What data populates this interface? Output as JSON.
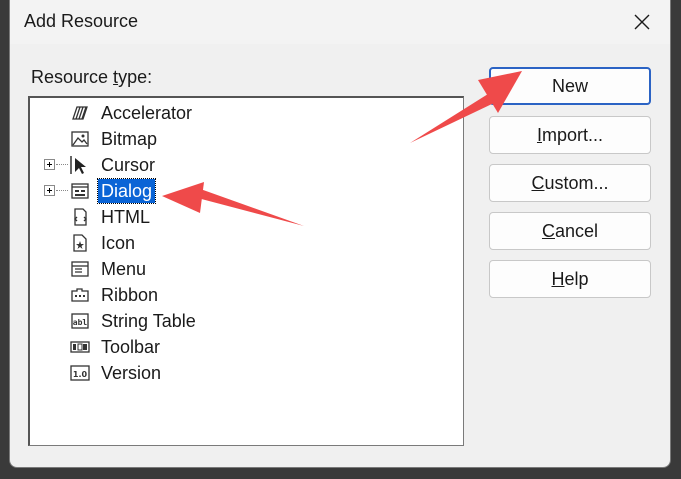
{
  "dialog": {
    "title": "Add Resource",
    "close_glyph": "close-icon"
  },
  "resource_type_label": {
    "pre": "Resource ",
    "ul": "t",
    "post": "ype:"
  },
  "tree": {
    "items": [
      {
        "label": "Accelerator",
        "icon": "accelerator-icon",
        "expandable": false,
        "selected": false
      },
      {
        "label": "Bitmap",
        "icon": "bitmap-icon",
        "expandable": false,
        "selected": false
      },
      {
        "label": "Cursor",
        "icon": "cursor-icon",
        "expandable": true,
        "selected": false
      },
      {
        "label": "Dialog",
        "icon": "dialog-icon",
        "expandable": true,
        "selected": true
      },
      {
        "label": "HTML",
        "icon": "html-icon",
        "expandable": false,
        "selected": false
      },
      {
        "label": "Icon",
        "icon": "icon-resource-icon",
        "expandable": false,
        "selected": false
      },
      {
        "label": "Menu",
        "icon": "menu-icon",
        "expandable": false,
        "selected": false
      },
      {
        "label": "Ribbon",
        "icon": "ribbon-icon",
        "expandable": false,
        "selected": false
      },
      {
        "label": "String Table",
        "icon": "string-table-icon",
        "expandable": false,
        "selected": false
      },
      {
        "label": "Toolbar",
        "icon": "toolbar-icon",
        "expandable": false,
        "selected": false
      },
      {
        "label": "Version",
        "icon": "version-icon",
        "expandable": false,
        "selected": false
      }
    ]
  },
  "buttons": {
    "new": {
      "label": "New"
    },
    "import": {
      "pre": "",
      "ul": "I",
      "post": "mport..."
    },
    "custom": {
      "pre": "",
      "ul": "C",
      "post": "ustom..."
    },
    "cancel": {
      "pre": "",
      "ul": "C",
      "post": "ancel"
    },
    "help": {
      "pre": "",
      "ul": "H",
      "post": "elp"
    }
  },
  "annotation_color": "#ef4a4a"
}
